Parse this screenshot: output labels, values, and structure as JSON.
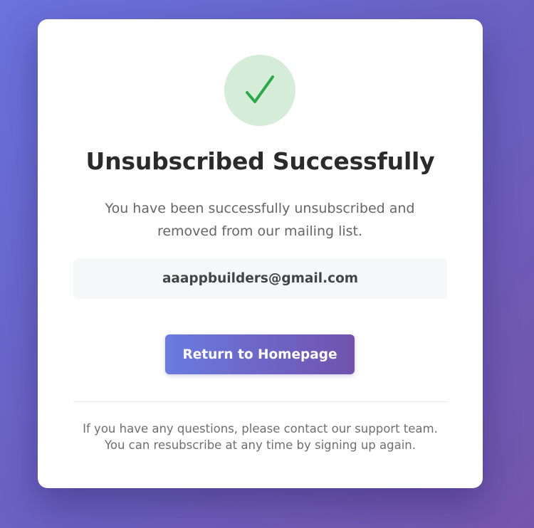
{
  "status": {
    "icon": "checkmark-icon",
    "icon_color": "#2aa84a",
    "circle_color": "#d5ecd9"
  },
  "title": "Unsubscribed Successfully",
  "message": "You have been successfully unsubscribed and removed from our mailing list.",
  "email": "aaappbuilders@gmail.com",
  "button_label": "Return to Homepage",
  "footer": {
    "line1": "If you have any questions, please contact our support team.",
    "line2": "You can resubscribe at any time by signing up again."
  }
}
